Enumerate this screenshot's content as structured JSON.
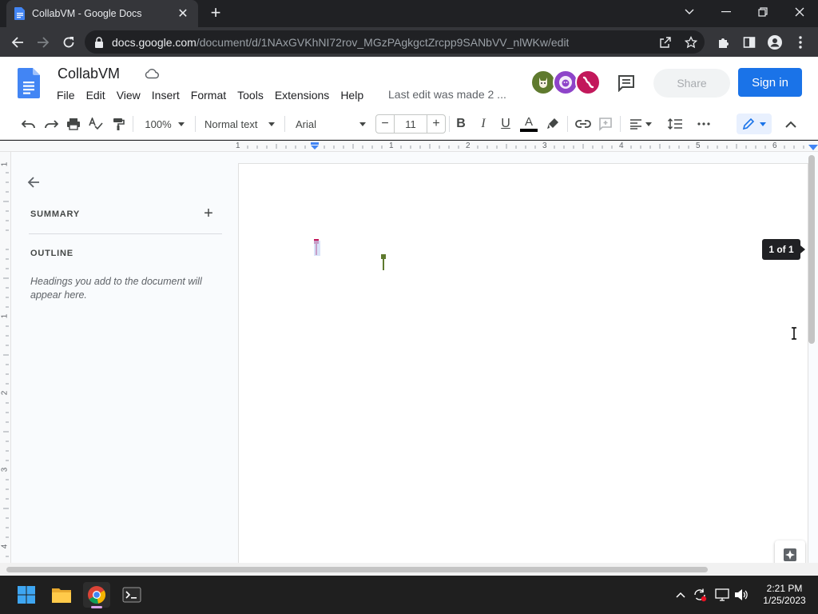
{
  "browser": {
    "tab_title": "CollabVM - Google Docs",
    "url_host": "docs.google.com",
    "url_path": "/document/d/1NAxGVKhNI72rov_MGzPAgkgctZrcpp9SANbVV_nlWKw/edit"
  },
  "docs": {
    "title": "CollabVM",
    "menu": [
      "File",
      "Edit",
      "View",
      "Insert",
      "Format",
      "Tools",
      "Extensions",
      "Help"
    ],
    "last_edit": "Last edit was made 2 ...",
    "share_label": "Share",
    "signin_label": "Sign in",
    "brand_color": "#1a73e8"
  },
  "toolbar": {
    "zoom": "100%",
    "style": "Normal text",
    "font": "Arial",
    "font_size": "11"
  },
  "ruler": {
    "h_numbers": [
      "1",
      "1",
      "2",
      "3",
      "4",
      "5",
      "6"
    ],
    "v_numbers": [
      "1",
      "1",
      "2",
      "3",
      "4"
    ]
  },
  "outline": {
    "summary_label": "SUMMARY",
    "outline_label": "OUTLINE",
    "hint": "Headings you add to the document will appear here."
  },
  "page": {
    "page_count": "1 of 1"
  },
  "collaborators": [
    {
      "icon": "dog-avatar-icon",
      "color": "#5f7a2e"
    },
    {
      "icon": "lion-avatar-icon",
      "color": "#8e44c9"
    },
    {
      "icon": "axolotl-avatar-icon",
      "color": "#c2185b"
    }
  ],
  "taskbar": {
    "time": "2:21 PM",
    "date": "1/25/2023"
  }
}
